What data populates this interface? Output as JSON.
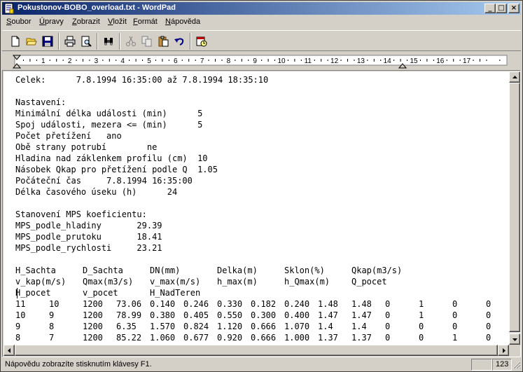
{
  "window": {
    "title": "Pokustonov-BOBO_overload.txt - WordPad",
    "controls": {
      "minimize": "_",
      "maximize": "□",
      "close": "×"
    }
  },
  "menu": {
    "items": [
      {
        "label": "Soubor",
        "key": "S"
      },
      {
        "label": "Úpravy",
        "key": "Ú"
      },
      {
        "label": "Zobrazit",
        "key": "Z"
      },
      {
        "label": "Vložit",
        "key": "V"
      },
      {
        "label": "Formát",
        "key": "F"
      },
      {
        "label": "Nápověda",
        "key": "N"
      }
    ]
  },
  "toolbar": {
    "buttons": [
      {
        "name": "new-document",
        "icon": "new-document-icon",
        "enabled": true
      },
      {
        "name": "open",
        "icon": "open-folder-icon",
        "enabled": true
      },
      {
        "name": "save",
        "icon": "floppy-disk-icon",
        "enabled": true
      },
      {
        "name": "print",
        "icon": "printer-icon",
        "enabled": true
      },
      {
        "name": "print-preview",
        "icon": "print-preview-icon",
        "enabled": true
      },
      {
        "name": "find",
        "icon": "binoculars-icon",
        "enabled": true
      },
      {
        "name": "cut",
        "icon": "scissors-icon",
        "enabled": false
      },
      {
        "name": "copy",
        "icon": "copy-icon",
        "enabled": false
      },
      {
        "name": "paste",
        "icon": "clipboard-icon",
        "enabled": true
      },
      {
        "name": "undo",
        "icon": "undo-arrow-icon",
        "enabled": true
      },
      {
        "name": "insert-datetime",
        "icon": "date-time-icon",
        "enabled": true
      }
    ]
  },
  "ruler": {
    "numbers": [
      "1",
      "2",
      "3",
      "4",
      "5",
      "6",
      "7",
      "8",
      "9",
      "10",
      "11",
      "12",
      "13",
      "14",
      "15",
      "16",
      "17"
    ]
  },
  "document": {
    "lines": [
      "Celek:      7.8.1994 16:35:00 až 7.8.1994 18:35:10",
      "",
      "Nastavení:",
      "Minimální délka události (min)      5",
      "Spoj události, mezera <= (min)      5",
      "Počet přetížení   ano",
      "Obě strany potrubí        ne",
      "Hladina nad záklenkem profilu (cm)  10",
      "Násobek Qkap pro přetížení podle Q  1.05",
      "Počáteční čas     7.8.1994 16:35:00",
      "Délka časového úseku (h)      24",
      "",
      "Stanovení MPS koeficientu:",
      "MPS_podle_hladiny       29.39",
      "MPS_podle_prutoku       18.41",
      "MPS_podle_rychlosti     23.21",
      ""
    ],
    "table_header": [
      [
        "H_Sachta",
        "D_Sachta",
        "DN(mm)",
        "Delka(m)",
        "Sklon(%)",
        "Qkap(m3/s)"
      ],
      [
        "v_kap(m/s)",
        "Qmax(m3/s)",
        "v_max(m/s)",
        "h_max(m)",
        "h_Qmax(m)",
        "Q_pocet"
      ],
      [
        "H_pocet",
        "v_pocet",
        "H_NadTeren"
      ]
    ],
    "table_rows": [
      [
        "11",
        "10",
        "1200",
        "73.06",
        "0.140",
        "0.246",
        "0.330",
        "0.182",
        "0.240",
        "1.48",
        "1.48",
        "0",
        "1",
        "0",
        "0"
      ],
      [
        "10",
        "9",
        "1200",
        "78.99",
        "0.380",
        "0.405",
        "0.550",
        "0.300",
        "0.400",
        "1.47",
        "1.47",
        "0",
        "1",
        "0",
        "0"
      ],
      [
        "9",
        "8",
        "1200",
        "6.35",
        "1.570",
        "0.824",
        "1.120",
        "0.666",
        "1.070",
        "1.4",
        "1.4",
        "0",
        "0",
        "0",
        "0"
      ],
      [
        "8",
        "7",
        "1200",
        "85.22",
        "1.060",
        "0.677",
        "0.920",
        "0.666",
        "1.000",
        "1.37",
        "1.37",
        "0",
        "0",
        "1",
        "0"
      ]
    ]
  },
  "statusbar": {
    "text": "Nápovědu zobrazíte stisknutím klávesy F1.",
    "panel_empty": "",
    "panel_num": "123"
  }
}
